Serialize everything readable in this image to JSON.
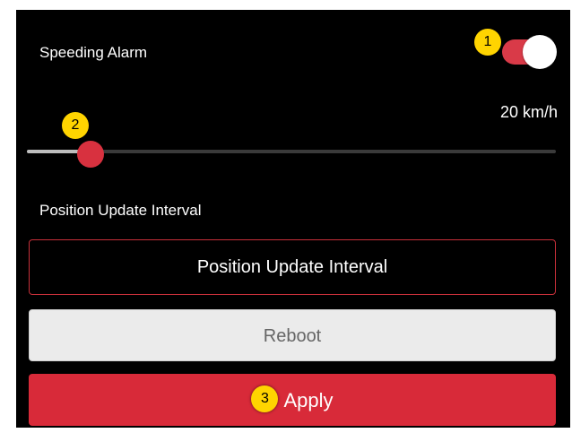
{
  "speeding_alarm": {
    "label": "Speeding Alarm",
    "enabled": true,
    "step_badge": "1"
  },
  "speed_slider": {
    "value_text": "20 km/h",
    "fraction": 0.12,
    "step_badge": "2"
  },
  "position_update": {
    "section_label": "Position Update Interval",
    "button_label": "Position Update Interval"
  },
  "buttons": {
    "reboot_label": "Reboot",
    "apply_label": "Apply",
    "apply_step_badge": "3"
  },
  "colors": {
    "background": "#000000",
    "accent_red": "#d82a39",
    "badge_yellow": "#ffd400",
    "reboot_bg": "#ebebeb"
  }
}
